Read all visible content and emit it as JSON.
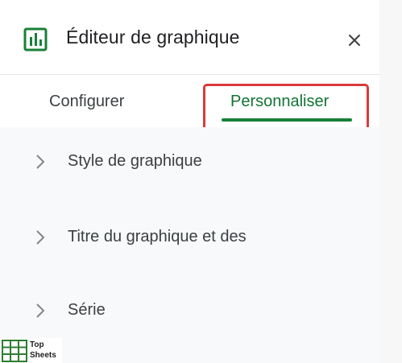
{
  "header": {
    "title": "Éditeur de graphique"
  },
  "tabs": [
    {
      "label": "Configurer",
      "active": false
    },
    {
      "label": "Personnaliser",
      "active": true
    }
  ],
  "sections": [
    {
      "label": "Style de graphique"
    },
    {
      "label": "Titre du graphique et des"
    },
    {
      "label": "Série"
    }
  ],
  "watermark": {
    "line1": "Top",
    "line2": "Sheets"
  },
  "colors": {
    "accent": "#188038",
    "highlight_box": "#d93a3a",
    "section_bg": "#f8f9fa"
  },
  "icons": {
    "header": "chart-icon",
    "close": "close-icon",
    "section": "chevron-right-icon"
  }
}
